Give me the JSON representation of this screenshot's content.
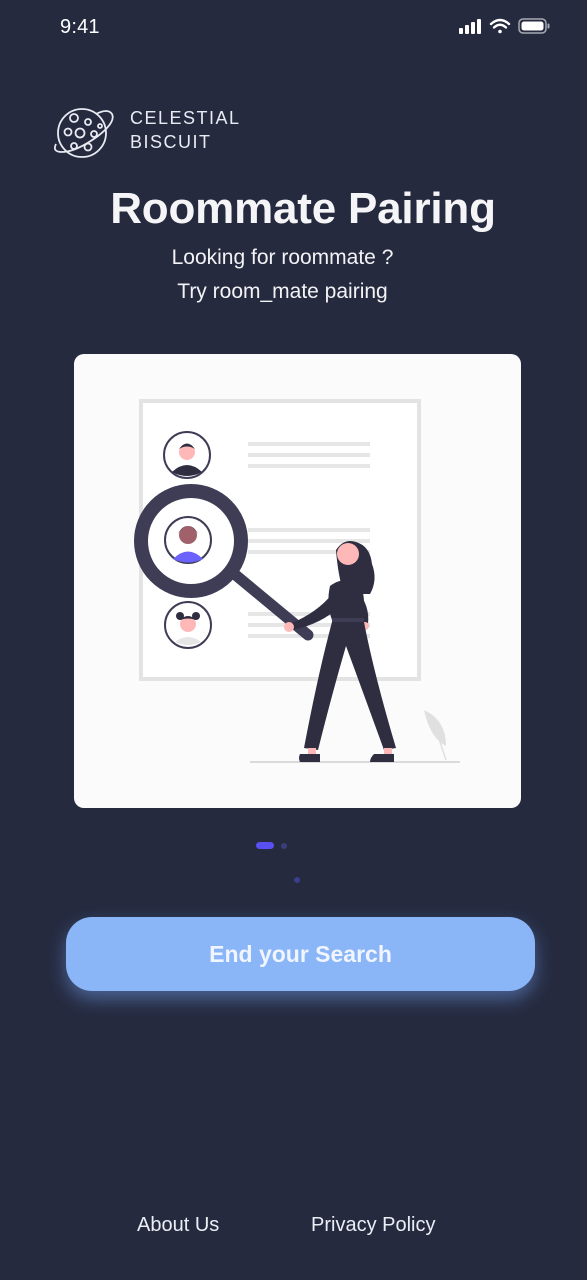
{
  "status_bar": {
    "time": "9:41",
    "icons": [
      "cellular-signal-icon",
      "wifi-icon",
      "battery-icon"
    ]
  },
  "brand": {
    "line1": "CELESTIAL",
    "line2": "BISCUIT",
    "logo_icon": "cookie-planet-icon"
  },
  "header": {
    "title": "Roommate Pairing",
    "subtitle_line1": "Looking for roommate ?",
    "subtitle_line2": "Try room_mate pairing"
  },
  "illustration": {
    "description_icon": "profile-search-illustration"
  },
  "pager": {
    "total": 2,
    "active_index": 0
  },
  "cta": {
    "label": "End your Search"
  },
  "footer": {
    "about_label": "About Us",
    "privacy_label": "Privacy Policy"
  },
  "colors": {
    "background": "#252a3f",
    "button": "#8ab5f7",
    "pager_active": "#5a4ff0",
    "card": "#fbfbfc",
    "illustration_accent": "#6c63ff",
    "illustration_dark": "#2f2e41"
  }
}
